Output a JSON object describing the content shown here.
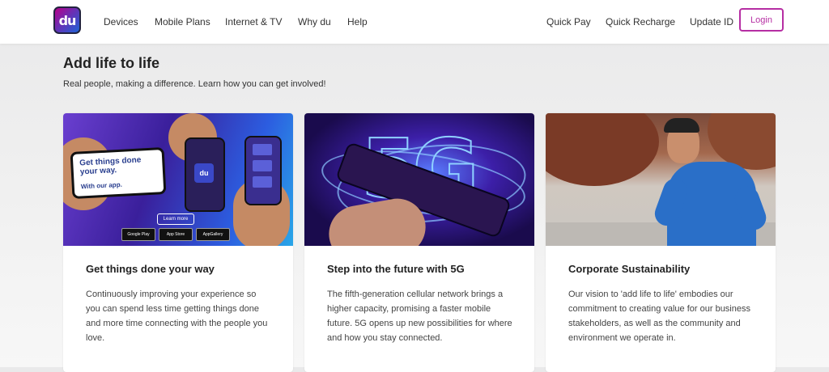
{
  "header": {
    "logo_text": "du",
    "nav_left": [
      "Devices",
      "Mobile Plans",
      "Internet & TV",
      "Why du",
      "Help"
    ],
    "nav_right": [
      "Quick Pay",
      "Quick Recharge",
      "Update ID"
    ],
    "login_label": "Login"
  },
  "hero": {
    "title": "Add life to life",
    "subtitle": "Real people, making a difference. Learn how you can get involved!"
  },
  "cards": [
    {
      "title": "Get things done your way",
      "body": "Continuously improving your experience so you can spend less time getting things done and more time connecting with the people you love.",
      "image": {
        "headline_1": "Get things done",
        "headline_2": "your way.",
        "headline_3": "With our app.",
        "learn_more": "Learn more",
        "stores": [
          "Google Play",
          "App Store",
          "AppGallery"
        ]
      }
    },
    {
      "title": "Step into the future with 5G",
      "body": "The fifth-generation cellular network brings a higher capacity, promising a faster mobile future. 5G opens up new possibilities for where and how you stay connected.",
      "image": {
        "big_text": "5G"
      }
    },
    {
      "title": "Corporate Sustainability",
      "body": "Our vision to 'add life to life' embodies our commitment to creating value for our business stakeholders, as well as the community and environment we operate in."
    }
  ],
  "colors": {
    "accent": "#b62ea3",
    "brand_blue": "#3a48c8"
  }
}
